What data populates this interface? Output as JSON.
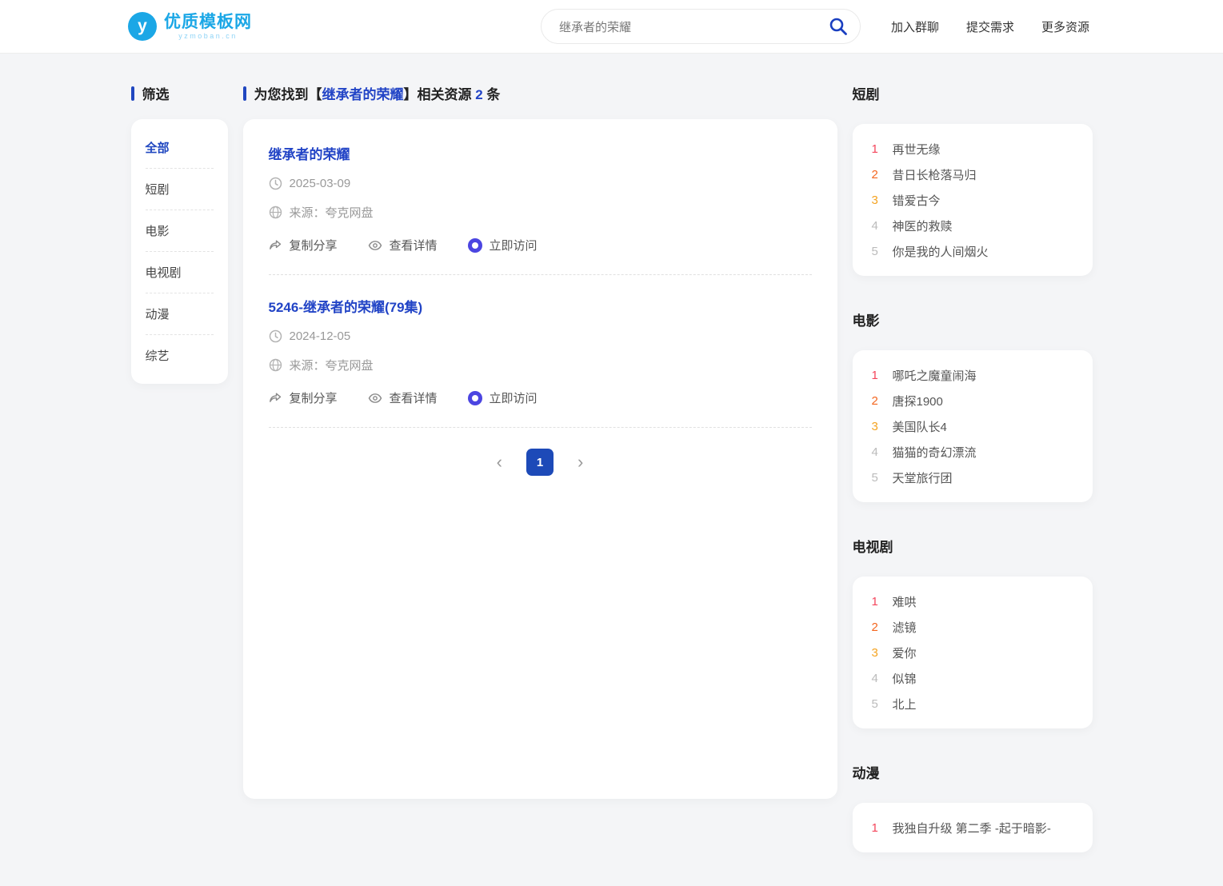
{
  "header": {
    "logo": {
      "icon_letter": "y",
      "name": "优质模板网",
      "domain": "yzmoban.cn"
    },
    "search": {
      "value": "继承者的荣耀"
    },
    "nav": [
      {
        "label": "加入群聊"
      },
      {
        "label": "提交需求"
      },
      {
        "label": "更多资源"
      }
    ]
  },
  "filter": {
    "title": "筛选",
    "items": [
      {
        "label": "全部",
        "active": true
      },
      {
        "label": "短剧",
        "active": false
      },
      {
        "label": "电影",
        "active": false
      },
      {
        "label": "电视剧",
        "active": false
      },
      {
        "label": "动漫",
        "active": false
      },
      {
        "label": "综艺",
        "active": false
      }
    ]
  },
  "results": {
    "heading": {
      "prefix": "为您找到【",
      "keyword": "继承者的荣耀",
      "middle": "】相关资源 ",
      "count": "2",
      "suffix": " 条"
    },
    "items": [
      {
        "title": "继承者的荣耀",
        "date": "2025-03-09",
        "source": "来源：夸克网盘",
        "share_label": "复制分享",
        "detail_label": "查看详情",
        "visit_label": "立即访问"
      },
      {
        "title": "5246-继承者的荣耀(79集)",
        "date": "2024-12-05",
        "source": "来源：夸克网盘",
        "share_label": "复制分享",
        "detail_label": "查看详情",
        "visit_label": "立即访问"
      }
    ],
    "pagination": {
      "prev": "‹",
      "current": "1",
      "next": "›"
    }
  },
  "rankings": [
    {
      "title": "短剧",
      "items": [
        {
          "rank": "1",
          "title": "再世无缘"
        },
        {
          "rank": "2",
          "title": "昔日长枪落马归"
        },
        {
          "rank": "3",
          "title": "错爱古今"
        },
        {
          "rank": "4",
          "title": "神医的救赎"
        },
        {
          "rank": "5",
          "title": "你是我的人间烟火"
        }
      ]
    },
    {
      "title": "电影",
      "items": [
        {
          "rank": "1",
          "title": "哪吒之魔童闹海"
        },
        {
          "rank": "2",
          "title": "唐探1900"
        },
        {
          "rank": "3",
          "title": "美国队长4"
        },
        {
          "rank": "4",
          "title": "猫猫的奇幻漂流"
        },
        {
          "rank": "5",
          "title": "天堂旅行团"
        }
      ]
    },
    {
      "title": "电视剧",
      "items": [
        {
          "rank": "1",
          "title": "难哄"
        },
        {
          "rank": "2",
          "title": "滤镜"
        },
        {
          "rank": "3",
          "title": "爱你"
        },
        {
          "rank": "4",
          "title": "似锦"
        },
        {
          "rank": "5",
          "title": "北上"
        }
      ]
    },
    {
      "title": "动漫",
      "items": [
        {
          "rank": "1",
          "title": "我独自升级 第二季 -起于暗影-"
        }
      ]
    }
  ],
  "colors": {
    "brand_blue": "#1ba7e6",
    "primary_blue": "#2244c6",
    "accent_bar": "#2047c0",
    "pagination_active": "#1d4ab8",
    "visit_icon": "#4b45e1",
    "rank1": "#f4465c",
    "rank2": "#f4661f",
    "rank3": "#f4a321",
    "rank_rest": "#bbbbbb",
    "page_bg": "#f4f5f7"
  }
}
